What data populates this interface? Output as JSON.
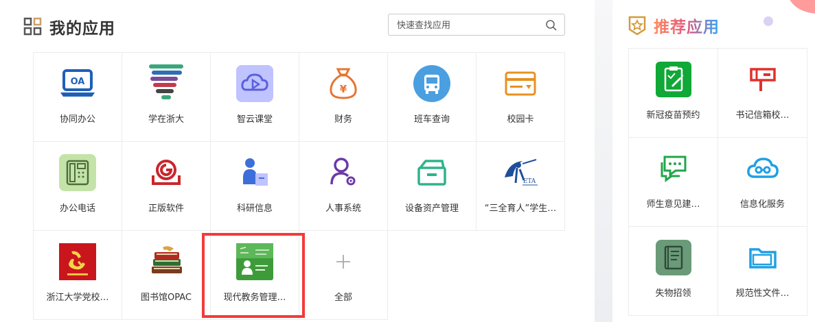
{
  "my_apps": {
    "title": "我的应用",
    "search_placeholder": "快速查找应用",
    "apps": [
      {
        "label": "协同办公",
        "icon": "oa-laptop-icon"
      },
      {
        "label": "学在浙大",
        "icon": "xuezai-logo-icon"
      },
      {
        "label": "智云课堂",
        "icon": "cloud-play-icon"
      },
      {
        "label": "财务",
        "icon": "money-bag-icon"
      },
      {
        "label": "班车查询",
        "icon": "bus-icon"
      },
      {
        "label": "校园卡",
        "icon": "campus-card-icon"
      },
      {
        "label": "办公电话",
        "icon": "telephone-icon"
      },
      {
        "label": "正版软件",
        "icon": "software-disc-icon"
      },
      {
        "label": "科研信息",
        "icon": "researcher-icon"
      },
      {
        "label": "人事系统",
        "icon": "person-gear-icon"
      },
      {
        "label": "设备资产管理",
        "icon": "asset-box-icon"
      },
      {
        "label": "“三全育人”学生…",
        "icon": "eta-logo-icon"
      },
      {
        "label": "浙江大学党校…",
        "icon": "party-school-icon"
      },
      {
        "label": "图书馆OPAC",
        "icon": "books-icon"
      },
      {
        "label": "现代教务管理…",
        "icon": "teaching-board-icon"
      },
      {
        "label": "全部",
        "icon": "plus-icon"
      }
    ]
  },
  "recommended": {
    "title": "推荐应用",
    "apps": [
      {
        "label": "新冠疫苗预约",
        "icon": "vaccine-clipboard-icon"
      },
      {
        "label": "书记信箱校…",
        "icon": "mailbox-icon"
      },
      {
        "label": "师生意见建…",
        "icon": "chat-bubble-icon"
      },
      {
        "label": "信息化服务",
        "icon": "cloud-link-icon"
      },
      {
        "label": "失物招领",
        "icon": "lost-found-book-icon"
      },
      {
        "label": "规范性文件…",
        "icon": "folder-icon"
      }
    ]
  },
  "highlight": {
    "app_label": "现代教务管理…",
    "color": "#f43a3a"
  }
}
